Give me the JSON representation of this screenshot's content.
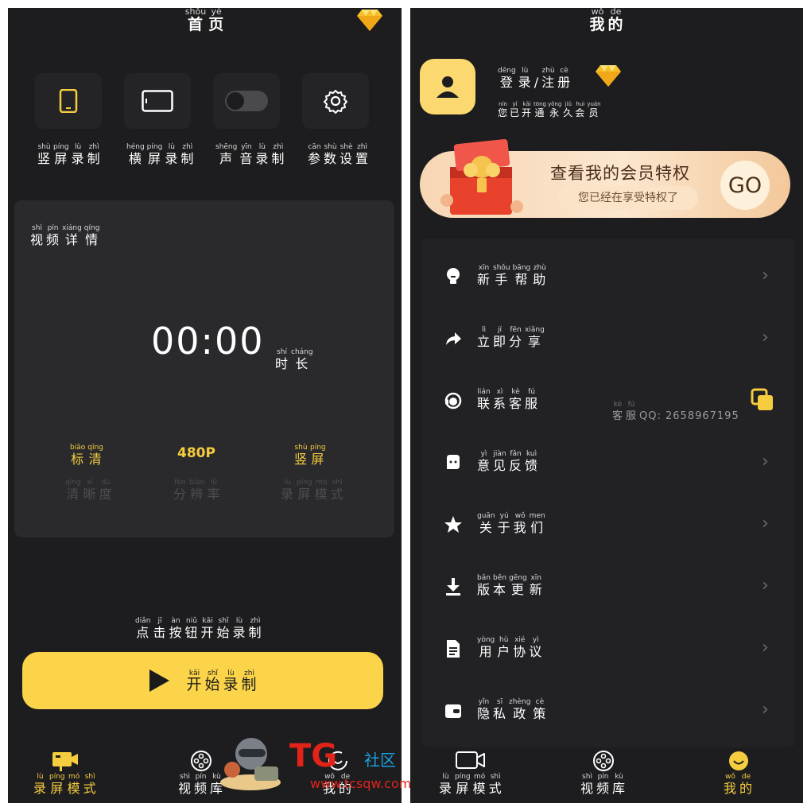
{
  "left": {
    "title": [
      {
        "p": "shǒu",
        "h": "首"
      },
      {
        "p": "yè",
        "h": "页"
      }
    ],
    "tools": [
      {
        "label": [
          {
            "p": "shù",
            "h": "竖"
          },
          {
            "p": "píng",
            "h": "屏"
          },
          {
            "p": "lù",
            "h": "录"
          },
          {
            "p": "zhì",
            "h": "制"
          }
        ]
      },
      {
        "label": [
          {
            "p": "héng",
            "h": "横"
          },
          {
            "p": "píng",
            "h": "屏"
          },
          {
            "p": "lù",
            "h": "录"
          },
          {
            "p": "zhì",
            "h": "制"
          }
        ]
      },
      {
        "label": [
          {
            "p": "shēng",
            "h": "声"
          },
          {
            "p": "yīn",
            "h": "音"
          },
          {
            "p": "lù",
            "h": "录"
          },
          {
            "p": "zhì",
            "h": "制"
          }
        ]
      },
      {
        "label": [
          {
            "p": "cān",
            "h": "参"
          },
          {
            "p": "shù",
            "h": "数"
          },
          {
            "p": "shè",
            "h": "设"
          },
          {
            "p": "zhì",
            "h": "置"
          }
        ]
      }
    ],
    "detail_title": [
      {
        "p": "shì",
        "h": "视"
      },
      {
        "p": "pín",
        "h": "频"
      },
      {
        "p": "xiáng",
        "h": "详"
      },
      {
        "p": "qíng",
        "h": "情"
      }
    ],
    "timer": "00:00",
    "duration_label": [
      {
        "p": "shí",
        "h": "时"
      },
      {
        "p": "cháng",
        "h": "长"
      }
    ],
    "quality_value": [
      {
        "p": "biāo",
        "h": "标"
      },
      {
        "p": "qīng",
        "h": "清"
      }
    ],
    "quality_label": [
      {
        "p": "qīng",
        "h": "清"
      },
      {
        "p": "xī",
        "h": "晰"
      },
      {
        "p": "dù",
        "h": "度"
      }
    ],
    "resolution_value": "480P",
    "resolution_label": [
      {
        "p": "fēn",
        "h": "分"
      },
      {
        "p": "biàn",
        "h": "辨"
      },
      {
        "p": "lǜ",
        "h": "率"
      }
    ],
    "mode_value": [
      {
        "p": "shù",
        "h": "竖"
      },
      {
        "p": "píng",
        "h": "屏"
      }
    ],
    "mode_label": [
      {
        "p": "lù",
        "h": "录"
      },
      {
        "p": "píng",
        "h": "屏"
      },
      {
        "p": "mó",
        "h": "模"
      },
      {
        "p": "shì",
        "h": "式"
      }
    ],
    "hint": [
      {
        "p": "diǎn",
        "h": "点"
      },
      {
        "p": "jī",
        "h": "击"
      },
      {
        "p": "àn",
        "h": "按"
      },
      {
        "p": "niǔ",
        "h": "钮"
      },
      {
        "p": "kāi",
        "h": "开"
      },
      {
        "p": "shǐ",
        "h": "始"
      },
      {
        "p": "lù",
        "h": "录"
      },
      {
        "p": "zhì",
        "h": "制"
      }
    ],
    "start_button": [
      {
        "p": "kāi",
        "h": "开"
      },
      {
        "p": "shǐ",
        "h": "始"
      },
      {
        "p": "lù",
        "h": "录"
      },
      {
        "p": "zhì",
        "h": "制"
      }
    ],
    "tabs": [
      {
        "icon": "camera-icon",
        "label": [
          {
            "p": "lù",
            "h": "录"
          },
          {
            "p": "píng",
            "h": "屏"
          },
          {
            "p": "mó",
            "h": "模"
          },
          {
            "p": "shì",
            "h": "式"
          }
        ],
        "active": true
      },
      {
        "icon": "film-reel-icon",
        "label": [
          {
            "p": "shì",
            "h": "视"
          },
          {
            "p": "pín",
            "h": "频"
          },
          {
            "p": "kù",
            "h": "库"
          }
        ],
        "active": false
      },
      {
        "icon": "smile-icon",
        "label": [
          {
            "p": "wǒ",
            "h": "我"
          },
          {
            "p": "de",
            "h": "的"
          }
        ],
        "active": false
      }
    ]
  },
  "right": {
    "title": [
      {
        "p": "wǒ",
        "h": "我"
      },
      {
        "p": "de",
        "h": "的"
      }
    ],
    "login": [
      {
        "p": "dēng",
        "h": "登"
      },
      {
        "p": "lù",
        "h": "录"
      },
      {
        "p": "",
        "h": "/"
      },
      {
        "p": "zhù",
        "h": "注"
      },
      {
        "p": "cè",
        "h": "册"
      }
    ],
    "member_status": [
      {
        "p": "nín",
        "h": "您"
      },
      {
        "p": "yǐ",
        "h": "已"
      },
      {
        "p": "kāi",
        "h": "开"
      },
      {
        "p": "tōng",
        "h": "通"
      },
      {
        "p": "yǒng",
        "h": "永"
      },
      {
        "p": "jiǔ",
        "h": "久"
      },
      {
        "p": "huì",
        "h": "会"
      },
      {
        "p": "yuán",
        "h": "员"
      }
    ],
    "banner": {
      "title": "查看我的会员特权",
      "subtitle": "您已经在享受特权了",
      "go": "GO"
    },
    "menu": [
      {
        "icon": "lightbulb-icon",
        "label": [
          {
            "p": "xīn",
            "h": "新"
          },
          {
            "p": "shǒu",
            "h": "手"
          },
          {
            "p": "bāng",
            "h": "帮"
          },
          {
            "p": "zhù",
            "h": "助"
          }
        ]
      },
      {
        "icon": "share-icon",
        "label": [
          {
            "p": "lì",
            "h": "立"
          },
          {
            "p": "jí",
            "h": "即"
          },
          {
            "p": "fēn",
            "h": "分"
          },
          {
            "p": "xiǎng",
            "h": "享"
          }
        ]
      },
      {
        "icon": "headset-icon",
        "label": [
          {
            "p": "lián",
            "h": "联"
          },
          {
            "p": "xì",
            "h": "系"
          },
          {
            "p": "kè",
            "h": "客"
          },
          {
            "p": "fú",
            "h": "服"
          }
        ],
        "qq": [
          {
            "p": "kè",
            "h": "客"
          },
          {
            "p": "fú",
            "h": "服"
          },
          {
            "p": "",
            "h": "QQ: 2658967195"
          }
        ]
      },
      {
        "icon": "feedback-icon",
        "label": [
          {
            "p": "yì",
            "h": "意"
          },
          {
            "p": "jiàn",
            "h": "见"
          },
          {
            "p": "fǎn",
            "h": "反"
          },
          {
            "p": "kuì",
            "h": "馈"
          }
        ]
      },
      {
        "icon": "star-icon",
        "label": [
          {
            "p": "guān",
            "h": "关"
          },
          {
            "p": "yú",
            "h": "于"
          },
          {
            "p": "wǒ",
            "h": "我"
          },
          {
            "p": "men",
            "h": "们"
          }
        ]
      },
      {
        "icon": "download-icon",
        "label": [
          {
            "p": "bǎn",
            "h": "版"
          },
          {
            "p": "běn",
            "h": "本"
          },
          {
            "p": "gēng",
            "h": "更"
          },
          {
            "p": "xīn",
            "h": "新"
          }
        ]
      },
      {
        "icon": "document-icon",
        "label": [
          {
            "p": "yòng",
            "h": "用"
          },
          {
            "p": "hù",
            "h": "户"
          },
          {
            "p": "xié",
            "h": "协"
          },
          {
            "p": "yì",
            "h": "议"
          }
        ]
      },
      {
        "icon": "wallet-icon",
        "label": [
          {
            "p": "yǐn",
            "h": "隐"
          },
          {
            "p": "sī",
            "h": "私"
          },
          {
            "p": "zhèng",
            "h": "政"
          },
          {
            "p": "cè",
            "h": "策"
          }
        ]
      }
    ],
    "tabs": [
      {
        "icon": "camera-icon",
        "label": [
          {
            "p": "lù",
            "h": "录"
          },
          {
            "p": "píng",
            "h": "屏"
          },
          {
            "p": "mó",
            "h": "模"
          },
          {
            "p": "shì",
            "h": "式"
          }
        ],
        "active": false
      },
      {
        "icon": "film-reel-icon",
        "label": [
          {
            "p": "shì",
            "h": "视"
          },
          {
            "p": "pín",
            "h": "频"
          },
          {
            "p": "kù",
            "h": "库"
          }
        ],
        "active": false
      },
      {
        "icon": "smile-icon",
        "label": [
          {
            "p": "wǒ",
            "h": "我"
          },
          {
            "p": "de",
            "h": "的"
          }
        ],
        "active": true
      }
    ]
  },
  "watermark": {
    "brand": "TG",
    "community": "社区",
    "site": "www.tcsqw.com"
  },
  "colors": {
    "accent": "#fbd44a",
    "background": "#1d1d1f",
    "card": "#2a2a2d"
  }
}
